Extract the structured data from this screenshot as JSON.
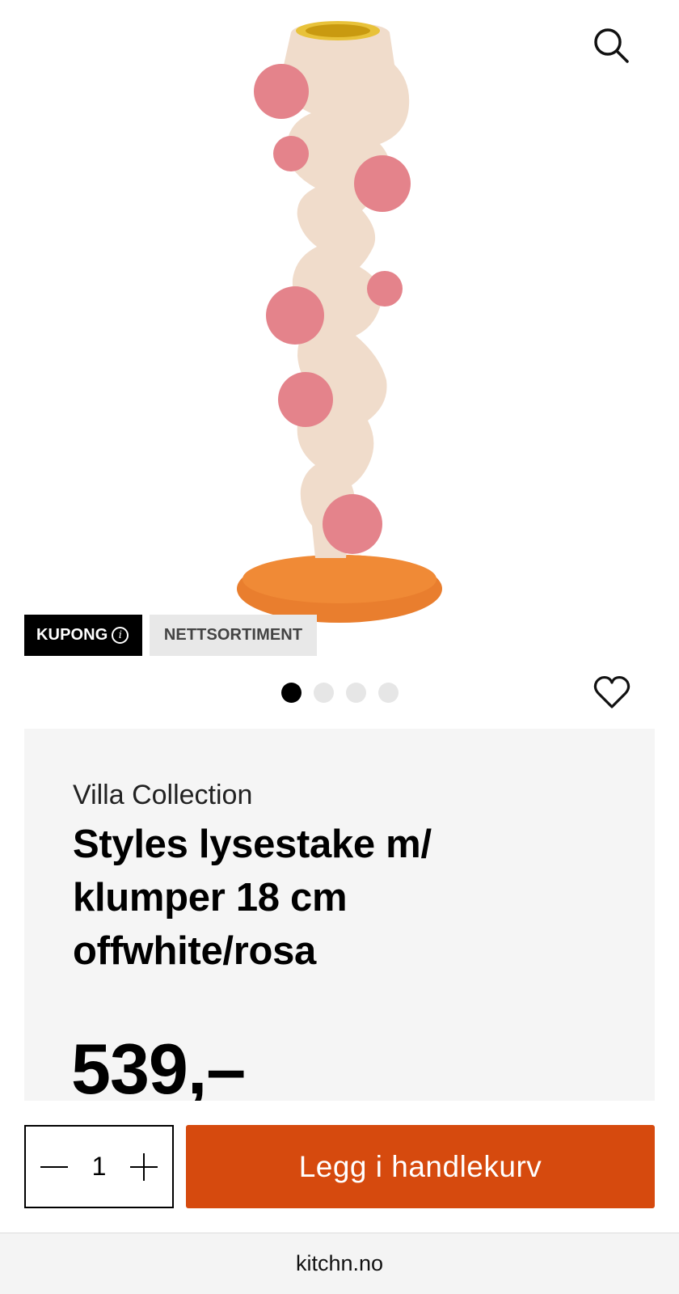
{
  "hero": {
    "image_alt": "product-photo-candlestick"
  },
  "header": {
    "search_icon": "search-icon"
  },
  "badges": {
    "kupong": "KUPONG",
    "info_icon": "info-icon",
    "nettsortiment": "NETTSORTIMENT"
  },
  "carousel": {
    "count": 4,
    "active_index": 0
  },
  "favorite": {
    "icon": "heart-icon"
  },
  "product": {
    "brand": "Villa Collection",
    "title": "Styles lysestake m/ klumper 18 cm offwhite/rosa",
    "price": "539,–"
  },
  "cart": {
    "quantity": "1",
    "decrease_icon": "minus-icon",
    "increase_icon": "plus-icon",
    "add_label": "Legg i handlekurv"
  },
  "browser": {
    "url": "kitchn.no"
  },
  "colors": {
    "accent": "#d64a0e",
    "panel": "#f5f5f5",
    "badge_dark": "#000000",
    "badge_light": "#e8e8e8"
  }
}
